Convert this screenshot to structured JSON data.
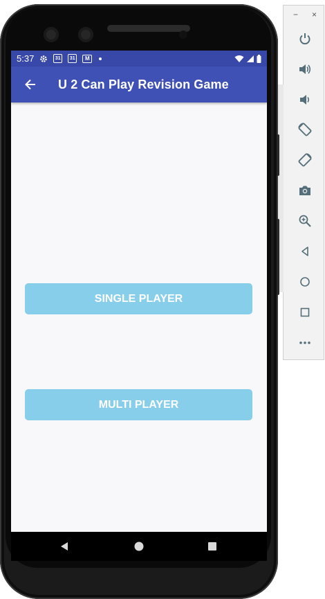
{
  "status_bar": {
    "time": "5:37",
    "calendar_date": "31",
    "mail_glyph": "M"
  },
  "app_bar": {
    "title": "U 2 Can Play Revision Game"
  },
  "buttons": {
    "single_player": "SINGLE PLAYER",
    "multi_player": "MULTI PLAYER"
  },
  "colors": {
    "status_bar": "#3848a8",
    "app_bar": "#3f51b5",
    "button": "#87ceeb",
    "screen_bg": "#f8f8fa"
  },
  "navigation": {
    "items": [
      "back-icon",
      "home-icon",
      "overview-icon"
    ]
  },
  "emulator_toolbar": {
    "window_controls": [
      "−",
      "×"
    ],
    "tools": [
      "power-icon",
      "volume-up-icon",
      "volume-down-icon",
      "rotate-left-icon",
      "rotate-right-icon",
      "screenshot-icon",
      "zoom-icon",
      "back-icon",
      "home-icon",
      "overview-icon",
      "more-icon"
    ]
  }
}
